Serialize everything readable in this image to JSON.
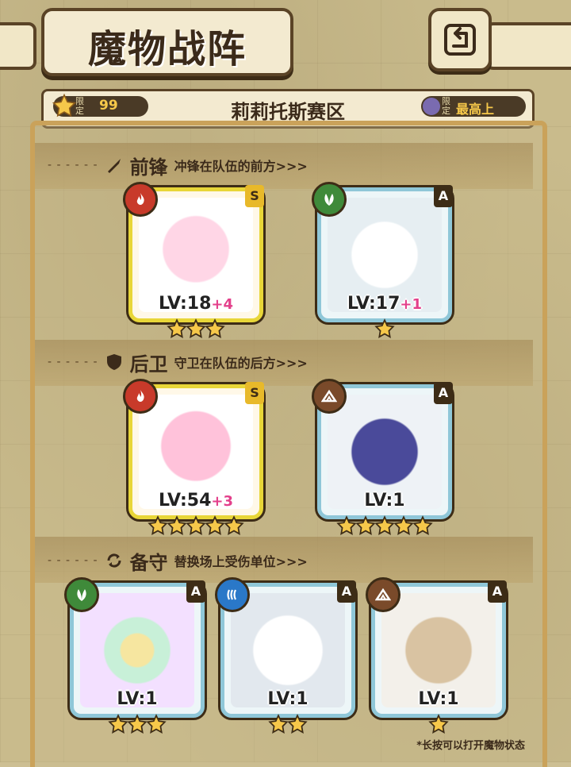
{
  "header": {
    "title": "魔物战阵",
    "back_icon": "back-arrow-icon"
  },
  "info_bar": {
    "limit_tag": "限定",
    "limit_value": "99",
    "region": "莉莉托斯赛区",
    "limit2_tag": "限定",
    "limit2_text": "最高上",
    "limit2_text_cutoff": true
  },
  "sections": {
    "front": {
      "title": "前锋",
      "desc": "冲锋在队伍的前方>>>",
      "icon": "sword-icon"
    },
    "back": {
      "title": "后卫",
      "desc": "守卫在队伍的后方>>>",
      "icon": "shield-icon"
    },
    "reserve": {
      "title": "备守",
      "desc": "替换场上受伤单位>>>",
      "icon": "swap-icon"
    }
  },
  "monsters": {
    "front1": {
      "element": "fire",
      "rank": "S",
      "lv": "LV:18",
      "plus": "+4",
      "stars": 3,
      "frame": "gold"
    },
    "front2": {
      "element": "wood",
      "rank": "A",
      "lv": "LV:17",
      "plus": "+1",
      "stars": 1,
      "frame": "blue"
    },
    "back1": {
      "element": "fire",
      "rank": "S",
      "lv": "LV:54",
      "plus": "+3",
      "stars": 5,
      "frame": "gold"
    },
    "back2": {
      "element": "earth",
      "rank": "A",
      "lv": "LV:1",
      "plus": "",
      "stars": 5,
      "frame": "blue"
    },
    "res1": {
      "element": "wood",
      "rank": "A",
      "lv": "LV:1",
      "plus": "",
      "stars": 3,
      "frame": "blue"
    },
    "res2": {
      "element": "water",
      "rank": "A",
      "lv": "LV:1",
      "plus": "",
      "stars": 2,
      "frame": "blue"
    },
    "res3": {
      "element": "earth",
      "rank": "A",
      "lv": "LV:1",
      "plus": "",
      "stars": 1,
      "frame": "blue"
    }
  },
  "colors": {
    "fire": "#c83a2a",
    "wood": "#3f8a3a",
    "earth": "#7a4a2a",
    "water": "#2a78c8"
  },
  "footer": {
    "note": "*长按可以打开魔物状态"
  }
}
